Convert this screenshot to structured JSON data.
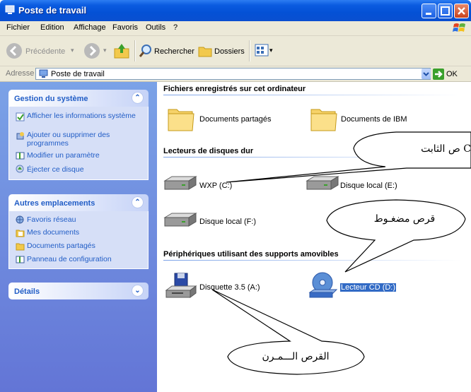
{
  "window": {
    "title": "Poste de travail"
  },
  "menu": [
    "Fichier",
    "Edition",
    "Affichage",
    "Favoris",
    "Outils",
    "?"
  ],
  "toolbar": {
    "back": "Précédente",
    "search": "Rechercher",
    "folders": "Dossiers"
  },
  "address": {
    "label": "Adresse",
    "value": "Poste de travail",
    "go": "OK"
  },
  "left": {
    "system": {
      "title": "Gestion du système",
      "items": [
        "Afficher les informations système",
        "Ajouter ou supprimer des programmes",
        "Modifier un paramètre",
        "Éjecter ce disque"
      ]
    },
    "places": {
      "title": "Autres emplacements",
      "items": [
        "Favoris réseau",
        "Mes documents",
        "Documents partagés",
        "Panneau de configuration"
      ]
    },
    "details": {
      "title": "Détails"
    }
  },
  "groups": {
    "files": {
      "title": "Fichiers enregistrés sur cet ordinateur",
      "items": [
        "Documents partagés",
        "Documents de IBM"
      ]
    },
    "drives": {
      "title": "Lecteurs de disques dur",
      "items": [
        "WXP (C:)",
        "Disque local (E:)",
        "Disque local (F:)"
      ]
    },
    "removable": {
      "title": "Périphériques utilisant des supports amovibles",
      "items": [
        "Disquette 3.5 (A:)",
        "Lecteur CD (D:)"
      ]
    }
  },
  "callouts": {
    "hard_disk": "C ص الثابت",
    "cd": "قرص مضغـوط",
    "floppy": "القرص الـــمـرن"
  },
  "colors": {
    "titlebar": "#0451d5",
    "leftpane": "#6f8fe0",
    "selection": "#316ac5",
    "link": "#215dc6"
  }
}
